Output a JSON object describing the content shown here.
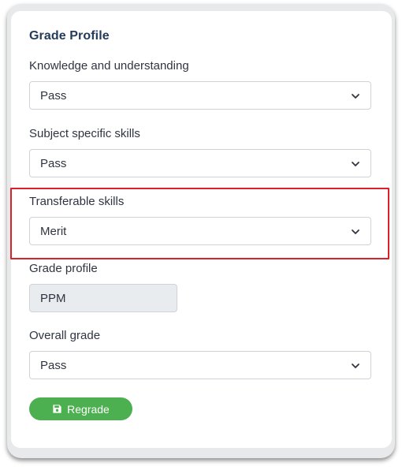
{
  "panel": {
    "title": "Grade Profile"
  },
  "fields": {
    "knowledge": {
      "label": "Knowledge and understanding",
      "value": "Pass"
    },
    "subject": {
      "label": "Subject specific skills",
      "value": "Pass"
    },
    "transferable": {
      "label": "Transferable skills",
      "value": "Merit"
    },
    "grade_profile": {
      "label": "Grade profile",
      "value": "PPM"
    },
    "overall": {
      "label": "Overall grade",
      "value": "Pass"
    }
  },
  "actions": {
    "regrade_label": "Regrade",
    "regrade_icon": "save-icon"
  },
  "colors": {
    "highlight": "#d9202b",
    "button": "#4caf50",
    "title": "#243b5a"
  }
}
